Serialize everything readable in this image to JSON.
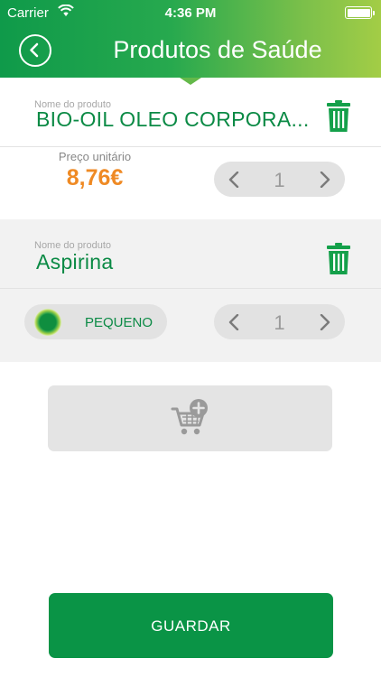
{
  "status_bar": {
    "carrier": "Carrier",
    "time": "4:36 PM"
  },
  "header": {
    "title": "Produtos de Saúde",
    "back_icon": "chevron-left-circle-icon"
  },
  "items": [
    {
      "name_label": "Nome do produto",
      "name": "BIO-OIL OLEO CORPORA...",
      "price_label": "Preço unitário",
      "price": "8,76€",
      "quantity": "1"
    },
    {
      "name_label": "Nome do produto",
      "name": "Aspirina",
      "size": "PEQUENO",
      "quantity": "1"
    }
  ],
  "add_cart": {
    "icon": "cart-plus-icon"
  },
  "save": {
    "label": "GUARDAR"
  },
  "colors": {
    "brand_green": "#0a9446",
    "price_orange": "#ef8a24",
    "accent_lime": "#a3cd46"
  }
}
